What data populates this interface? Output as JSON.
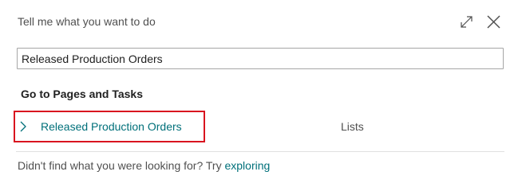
{
  "dialog": {
    "title": "Tell me what you want to do",
    "expand_icon": "expand-icon",
    "close_icon": "close-icon"
  },
  "search": {
    "value": "Released Production Orders",
    "placeholder": ""
  },
  "results": {
    "heading": "Go to Pages and Tasks",
    "items": [
      {
        "name": "Released Production Orders",
        "category": "Lists",
        "icon": "chevron-right-icon"
      }
    ]
  },
  "footer": {
    "text": "Didn't find what you were looking for? Try ",
    "link_label": "exploring"
  },
  "colors": {
    "link": "#00707a",
    "highlight": "#d9141f",
    "text": "#212121",
    "muted": "#505050"
  }
}
